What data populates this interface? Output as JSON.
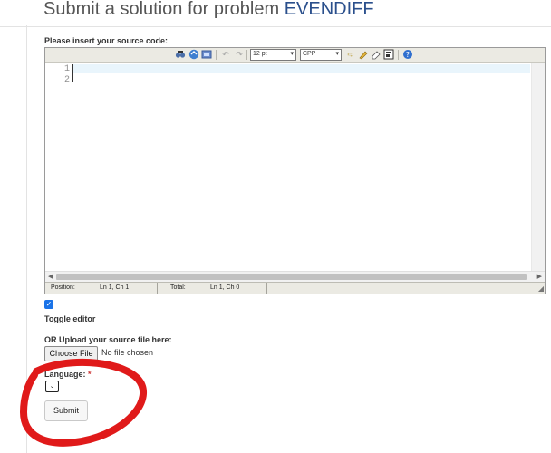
{
  "page": {
    "title_prefix": "Submit a solution for problem",
    "problem_code": "EVENDIFF"
  },
  "editor": {
    "label": "Please insert your source code:",
    "font_size": "12 pt",
    "language_mode": "CPP",
    "line_numbers": [
      "1",
      "2"
    ],
    "toolbar_icons": [
      "search-icon",
      "replace-icon",
      "fullscreen-icon",
      "undo-icon",
      "redo-icon",
      "highlight-icon",
      "reset-icon",
      "word-wrap-icon",
      "help-icon"
    ],
    "status": {
      "position_label": "Position:",
      "position_value": "Ln 1, Ch 1",
      "total_label": "Total:",
      "total_value": "Ln 1, Ch 0"
    }
  },
  "toggle_editor": {
    "label": "Toggle editor",
    "checked": true
  },
  "upload": {
    "label": "OR Upload your source file here:",
    "button_label": "Choose File",
    "status": "No file chosen"
  },
  "language": {
    "label": "Language:",
    "required_mark": "*",
    "selected": ""
  },
  "submit": {
    "label": "Submit"
  },
  "colors": {
    "accent": "#2a4f8c",
    "annotation": "#e01a1a",
    "checkbox": "#1a73e8"
  }
}
